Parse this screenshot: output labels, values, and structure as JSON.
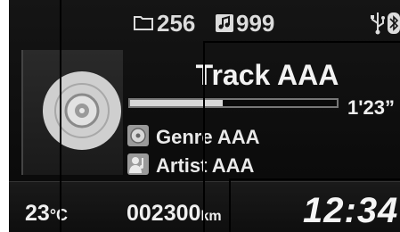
{
  "status": {
    "folder_icon": "folder-icon",
    "folder_count": "256",
    "track_icon": "music-note-icon",
    "track_count": "999",
    "usb_icon": "usb-icon",
    "bluetooth_icon": "bluetooth-icon"
  },
  "album": {
    "icon": "disc-icon"
  },
  "now_playing": {
    "title": "Track AAA",
    "elapsed": "1'23”",
    "progress": 0.45,
    "genre_icon": "genre-icon",
    "genre": "Genre AAA",
    "artist_icon": "artist-icon",
    "artist": "Artist AAA"
  },
  "footer": {
    "temperature": "23",
    "temperature_unit": "°C",
    "odometer": "002300",
    "odometer_unit": "km",
    "clock": "12:34"
  },
  "colors": {
    "screen_bg": "#121212",
    "text": "#f0f0f0",
    "progress_fill": "#d8d8d8",
    "callout": "#000000"
  }
}
